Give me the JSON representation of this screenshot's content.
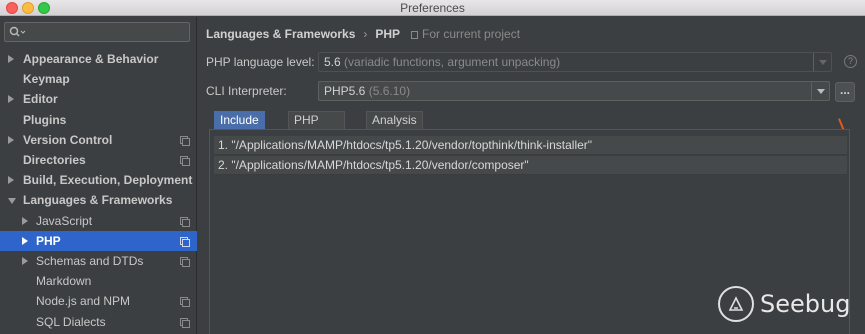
{
  "window": {
    "title": "Preferences"
  },
  "sidebar": {
    "search_placeholder": "",
    "items": [
      {
        "label": "Appearance & Behavior",
        "bold": true,
        "arrow": "right",
        "indent": 0,
        "copy": false
      },
      {
        "label": "Keymap",
        "bold": true,
        "arrow": "none",
        "indent": 0,
        "copy": false
      },
      {
        "label": "Editor",
        "bold": true,
        "arrow": "right",
        "indent": 0,
        "copy": false
      },
      {
        "label": "Plugins",
        "bold": true,
        "arrow": "none",
        "indent": 0,
        "copy": false
      },
      {
        "label": "Version Control",
        "bold": true,
        "arrow": "right",
        "indent": 0,
        "copy": true
      },
      {
        "label": "Directories",
        "bold": true,
        "arrow": "none",
        "indent": 0,
        "copy": true
      },
      {
        "label": "Build, Execution, Deployment",
        "bold": true,
        "arrow": "right",
        "indent": 0,
        "copy": false
      },
      {
        "label": "Languages & Frameworks",
        "bold": true,
        "arrow": "down",
        "indent": 0,
        "copy": false
      },
      {
        "label": "JavaScript",
        "bold": false,
        "arrow": "right",
        "indent": 1,
        "copy": true
      },
      {
        "label": "PHP",
        "bold": true,
        "arrow": "right",
        "indent": 1,
        "copy": true,
        "selected": true
      },
      {
        "label": "Schemas and DTDs",
        "bold": false,
        "arrow": "right",
        "indent": 1,
        "copy": true
      },
      {
        "label": "Markdown",
        "bold": false,
        "arrow": "none",
        "indent": 1,
        "copy": false
      },
      {
        "label": "Node.js and NPM",
        "bold": false,
        "arrow": "none",
        "indent": 1,
        "copy": true
      },
      {
        "label": "SQL Dialects",
        "bold": false,
        "arrow": "none",
        "indent": 1,
        "copy": true
      }
    ]
  },
  "breadcrumb": {
    "parent": "Languages & Frameworks",
    "separator": "›",
    "current": "PHP",
    "scope": "For current project"
  },
  "php_language_level": {
    "label": "PHP language level:",
    "value": "5.6",
    "detail": "(variadic functions, argument unpacking)"
  },
  "cli_interpreter": {
    "label": "CLI Interpreter:",
    "value": "PHP5.6",
    "detail": "(5.6.10)",
    "more": "..."
  },
  "help": {
    "glyph": "?"
  },
  "tabs": [
    {
      "label": "Include Path",
      "active": true
    },
    {
      "label": "PHP Runtime",
      "active": false
    },
    {
      "label": "Analysis",
      "active": false
    }
  ],
  "include_paths": [
    "1. \"/Applications/MAMP/htdocs/tp5.1.20/vendor/topthink/think-installer\"",
    "2. \"/Applications/MAMP/htdocs/tp5.1.20/vendor/composer\""
  ],
  "watermark": {
    "text": "Seebug"
  },
  "colors": {
    "selection": "#2f65ca",
    "active_tab": "#4a6ea9",
    "background": "#3c3f41"
  },
  "icons": {
    "search": "search-icon",
    "copy": "project-copy-icon",
    "dropdown": "chevron-down-icon"
  }
}
